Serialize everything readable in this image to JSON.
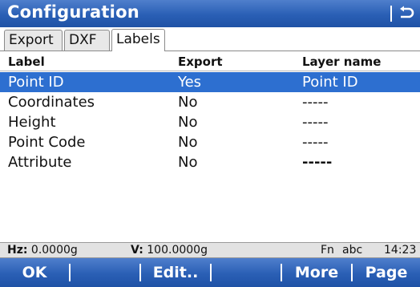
{
  "title": "Configuration",
  "tabs": [
    {
      "label": "Export",
      "active": false
    },
    {
      "label": "DXF",
      "active": false
    },
    {
      "label": "Labels",
      "active": true
    }
  ],
  "columns": {
    "label": "Label",
    "export": "Export",
    "layer": "Layer name"
  },
  "rows": [
    {
      "label": "Point ID",
      "export": "Yes",
      "layer": "Point ID",
      "selected": true
    },
    {
      "label": "Coordinates",
      "export": "No",
      "layer": "-----",
      "selected": false
    },
    {
      "label": "Height",
      "export": "No",
      "layer": "-----",
      "selected": false
    },
    {
      "label": "Point Code",
      "export": "No",
      "layer": "-----",
      "selected": false
    },
    {
      "label": "Attribute",
      "export": "No",
      "layer": "-----",
      "selected": false
    }
  ],
  "status": {
    "hz_label": "Hz:",
    "hz_value": "0.0000g",
    "v_label": "V:",
    "v_value": "100.0000g",
    "fn": "Fn",
    "input_mode": "abc",
    "time": "14:23"
  },
  "softkeys": {
    "f1": "OK",
    "f2": "",
    "f3": "Edit..",
    "f4": "",
    "f5": "More",
    "f6": "Page"
  },
  "colors": {
    "accent": "#2a5fb5",
    "selection": "#2d6fd0",
    "status_bg": "#e2e2e2"
  }
}
